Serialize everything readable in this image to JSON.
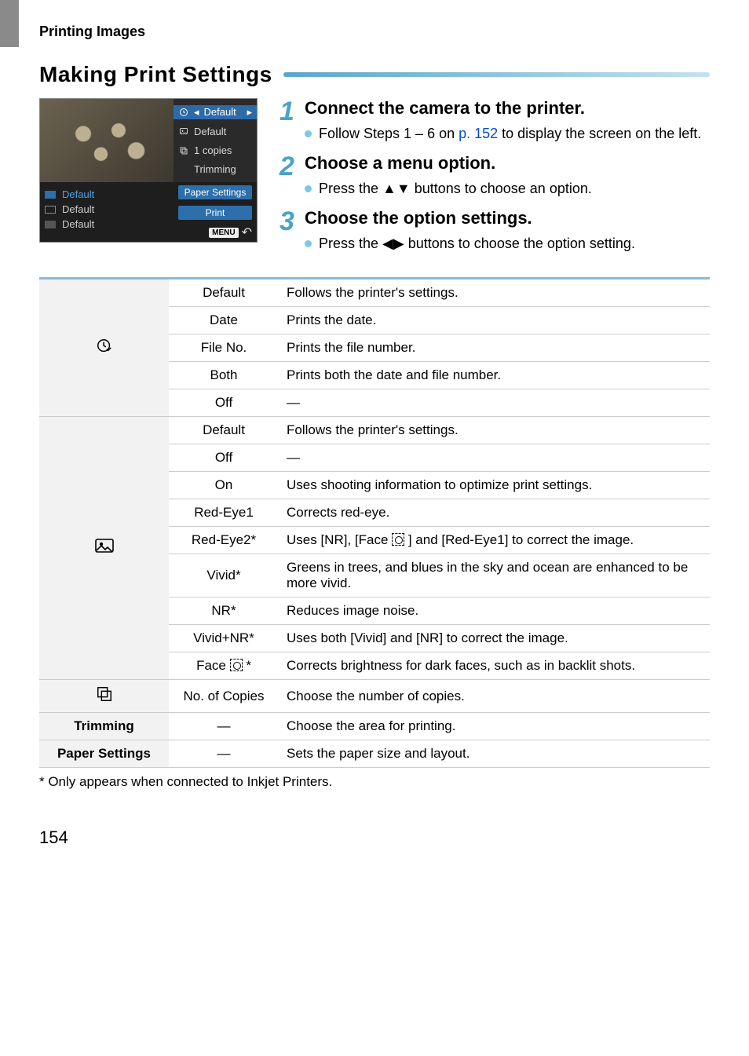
{
  "section": "Printing Images",
  "heading": "Making Print Settings",
  "lcd": {
    "right": [
      "Default",
      "Default",
      "1  copies",
      "Trimming"
    ],
    "left": [
      "Default",
      "Default",
      "Default"
    ],
    "paper": "Paper Settings",
    "print": "Print",
    "menu": "MENU"
  },
  "steps": [
    {
      "num": "1",
      "title": "Connect the camera to the printer.",
      "bullets": [
        {
          "pre": "Follow Steps 1 – 6 on ",
          "link": "p. 152",
          "post": " to display the screen on the left."
        }
      ]
    },
    {
      "num": "2",
      "title": "Choose a menu option.",
      "bullets": [
        {
          "pre": "Press the ",
          "sym": "▲▼",
          "post": " buttons to choose an option."
        }
      ]
    },
    {
      "num": "3",
      "title": "Choose the option settings.",
      "bullets": [
        {
          "pre": "Press the ",
          "sym": "◀▶",
          "post": " buttons to choose the option setting."
        }
      ]
    }
  ],
  "table": {
    "group1": {
      "iconSvg": "clock-check",
      "rows": [
        {
          "opt": "Default",
          "desc": "Follows the printer's settings."
        },
        {
          "opt": "Date",
          "desc": "Prints the date."
        },
        {
          "opt": "File No.",
          "desc": "Prints the file number."
        },
        {
          "opt": "Both",
          "desc": "Prints both the date and file number."
        },
        {
          "opt": "Off",
          "desc": "—"
        }
      ]
    },
    "group2": {
      "iconSvg": "photo",
      "rows": [
        {
          "opt": "Default",
          "desc": "Follows the printer's settings."
        },
        {
          "opt": "Off",
          "desc": "—"
        },
        {
          "opt": "On",
          "desc": "Uses shooting information to optimize print settings."
        },
        {
          "opt": "Red-Eye1",
          "desc": "Corrects red-eye."
        },
        {
          "opt": "Red-Eye2*",
          "desc_pre": "Uses [NR], [Face ",
          "desc_post": " ] and [Red-Eye1] to correct the image.",
          "face": true
        },
        {
          "opt": "Vivid*",
          "desc": "Greens in trees, and blues in the sky and ocean are enhanced to be more vivid."
        },
        {
          "opt": "NR*",
          "desc": "Reduces image noise."
        },
        {
          "opt": "Vivid+NR*",
          "desc": "Uses both [Vivid] and [NR] to correct the image."
        },
        {
          "opt": "Face",
          "face": true,
          "optsuffix": " *",
          "desc": "Corrects brightness for dark faces, such as in backlit shots."
        }
      ]
    },
    "group3": {
      "icon": "copies",
      "opt": "No. of Copies",
      "desc": "Choose the number of copies."
    },
    "trimming": {
      "label": "Trimming",
      "opt": "—",
      "desc": "Choose the area for printing."
    },
    "paper": {
      "label": "Paper Settings",
      "opt": "—",
      "desc": "Sets the paper size and layout."
    }
  },
  "footnote": "*  Only appears when connected to Inkjet Printers.",
  "page": "154"
}
